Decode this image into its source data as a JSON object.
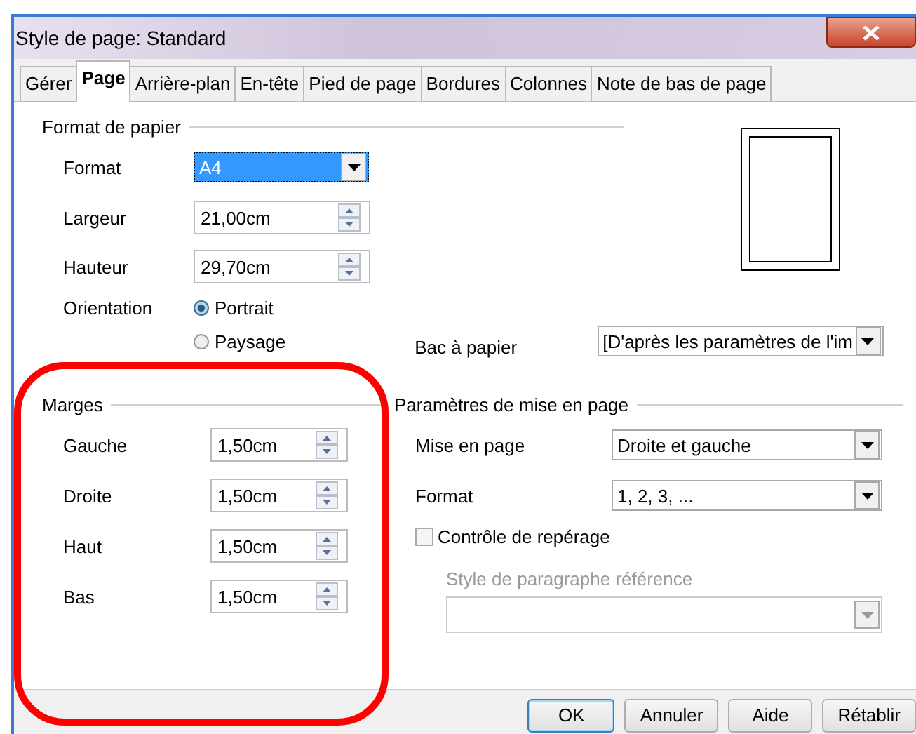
{
  "window": {
    "title": "Style de page: Standard"
  },
  "tabs": [
    {
      "label": "Gérer",
      "selected": false
    },
    {
      "label": "Page",
      "selected": true
    },
    {
      "label": "Arrière-plan",
      "selected": false
    },
    {
      "label": "En-tête",
      "selected": false
    },
    {
      "label": "Pied de page",
      "selected": false
    },
    {
      "label": "Bordures",
      "selected": false
    },
    {
      "label": "Colonnes",
      "selected": false
    },
    {
      "label": "Note de bas de page",
      "selected": false
    }
  ],
  "paper_format": {
    "title": "Format de papier",
    "format": {
      "label": "Format",
      "value": "A4"
    },
    "width": {
      "label": "Largeur",
      "value": "21,00cm"
    },
    "height": {
      "label": "Hauteur",
      "value": "29,70cm"
    },
    "orientation": {
      "label": "Orientation",
      "options": [
        {
          "label": "Portrait",
          "selected": true
        },
        {
          "label": "Paysage",
          "selected": false
        }
      ]
    },
    "paper_tray": {
      "label": "Bac à papier",
      "value": "[D'après les paramètres de l'im"
    }
  },
  "margins": {
    "title": "Marges",
    "fields": [
      {
        "label": "Gauche",
        "value": "1,50cm"
      },
      {
        "label": "Droite",
        "value": "1,50cm"
      },
      {
        "label": "Haut",
        "value": "1,50cm"
      },
      {
        "label": "Bas",
        "value": "1,50cm"
      }
    ]
  },
  "layout_settings": {
    "title": "Paramètres de mise en page",
    "page_layout": {
      "label": "Mise en page",
      "value": "Droite et gauche"
    },
    "format": {
      "label": "Format",
      "value": "1, 2, 3, ..."
    },
    "register_true": {
      "label": "Contrôle de repérage",
      "checked": false
    },
    "reference_style": {
      "label": "Style de paragraphe référence",
      "disabled": true
    }
  },
  "buttons": [
    "OK",
    "Annuler",
    "Aide",
    "Rétablir"
  ]
}
